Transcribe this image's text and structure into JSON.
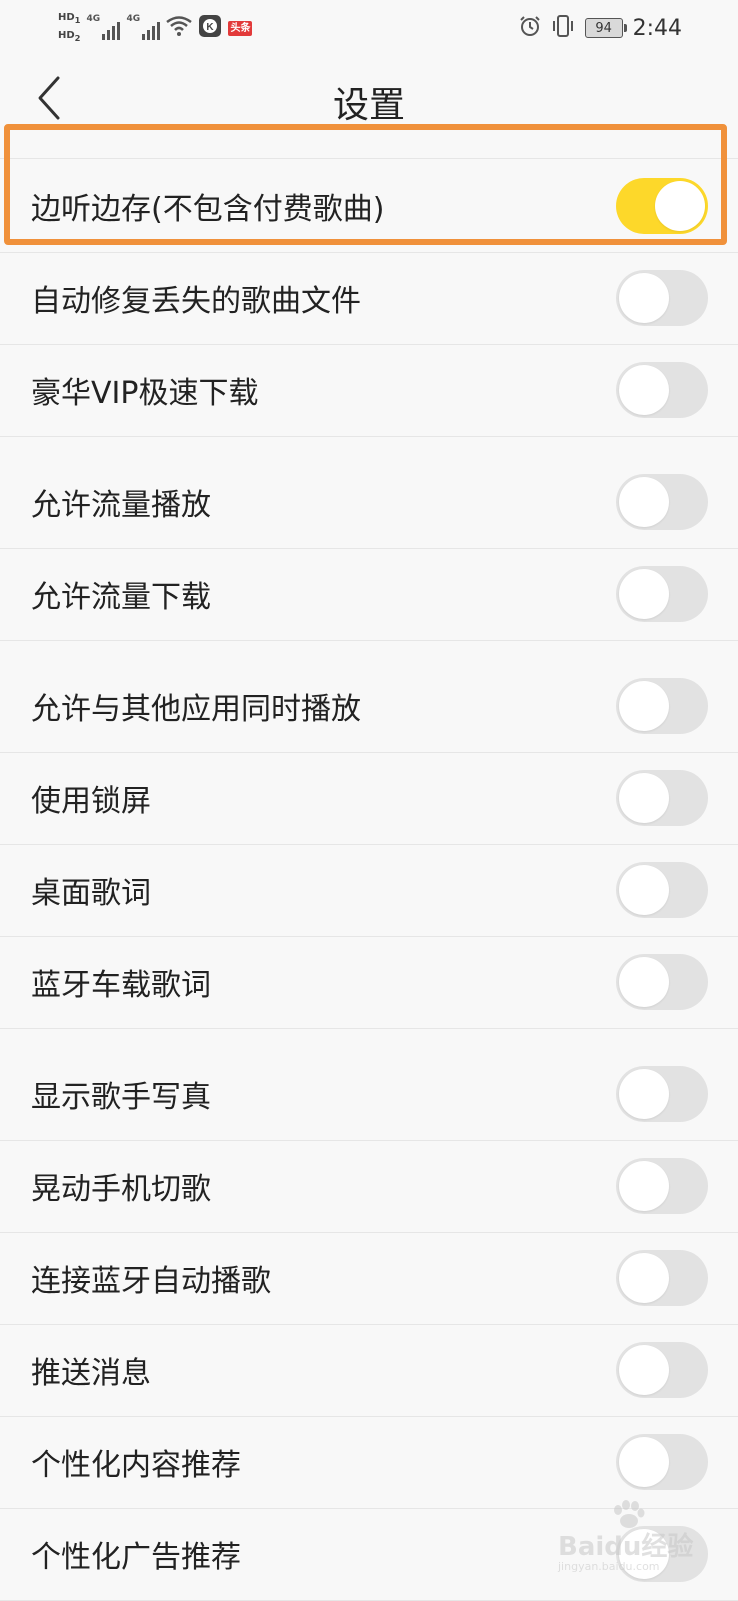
{
  "status_bar": {
    "hd_top": "HD",
    "hd_top_sub": "1",
    "hd_bottom": "HD",
    "hd_bottom_sub": "2",
    "network1": "4G",
    "network2": "4G",
    "toutiao": "头条",
    "battery": "94",
    "time": "2:44"
  },
  "header": {
    "title": "设置"
  },
  "settings": [
    {
      "label": "边听边存(不包含付费歌曲)",
      "on": true
    },
    {
      "label": "自动修复丢失的歌曲文件",
      "on": false
    },
    {
      "label": "豪华VIP极速下载",
      "on": false
    },
    {
      "label": "允许流量播放",
      "on": false
    },
    {
      "label": "允许流量下载",
      "on": false
    },
    {
      "label": "允许与其他应用同时播放",
      "on": false
    },
    {
      "label": "使用锁屏",
      "on": false
    },
    {
      "label": "桌面歌词",
      "on": false
    },
    {
      "label": "蓝牙车载歌词",
      "on": false
    },
    {
      "label": "显示歌手写真",
      "on": false
    },
    {
      "label": "晃动手机切歌",
      "on": false
    },
    {
      "label": "连接蓝牙自动播歌",
      "on": false
    },
    {
      "label": "推送消息",
      "on": false
    },
    {
      "label": "个性化内容推荐",
      "on": false
    },
    {
      "label": "个性化广告推荐",
      "on": false
    }
  ],
  "colors": {
    "toggle_on": "#fdd82a",
    "toggle_off": "#e2e2e2",
    "highlight": "#f0913b"
  },
  "watermark": {
    "text": "Baidu经验",
    "sub": "jingyan.baidu.com"
  }
}
